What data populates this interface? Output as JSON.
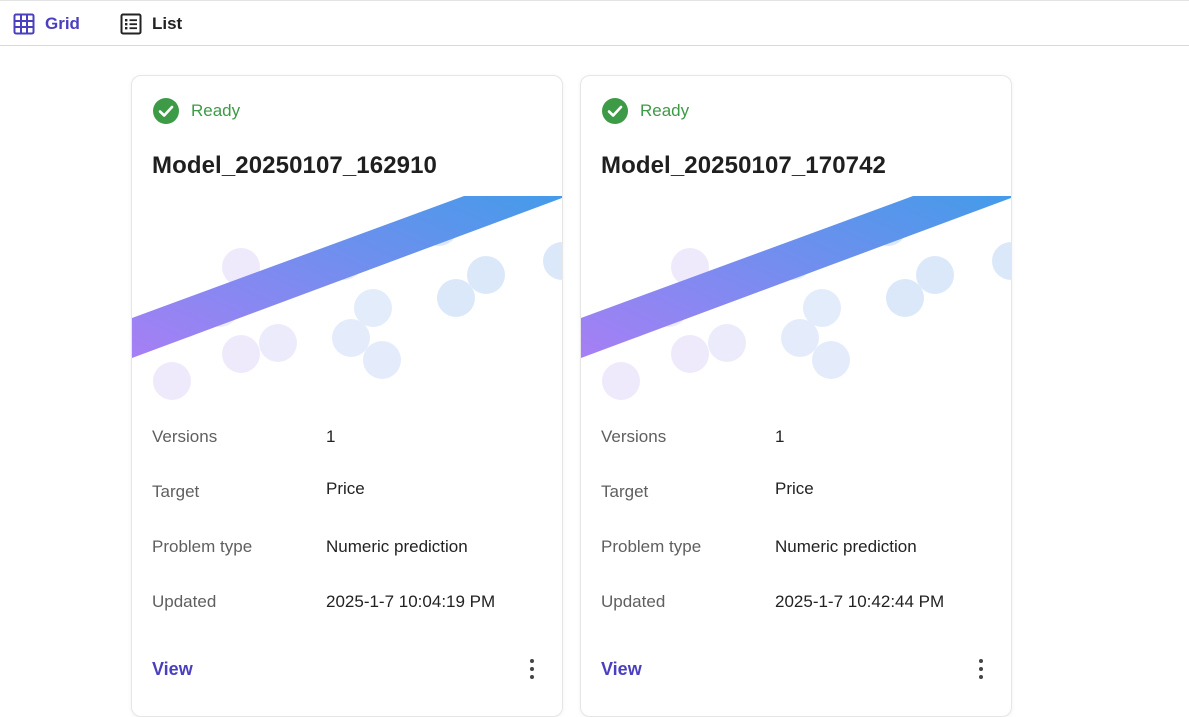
{
  "toolbar": {
    "grid_label": "Grid",
    "list_label": "List",
    "active_color": "#4a3fbf"
  },
  "cards": [
    {
      "status": "Ready",
      "title": "Model_20250107_162910",
      "fields": [
        {
          "label": "Versions",
          "value": "1"
        },
        {
          "label": "Target",
          "value": "Price"
        },
        {
          "label": "Problem type",
          "value": "Numeric prediction"
        },
        {
          "label": "Updated",
          "value": "2025-1-7 10:04:19 PM"
        }
      ],
      "view_label": "View"
    },
    {
      "status": "Ready",
      "title": "Model_20250107_170742",
      "fields": [
        {
          "label": "Versions",
          "value": "1"
        },
        {
          "label": "Target",
          "value": "Price"
        },
        {
          "label": "Problem type",
          "value": "Numeric prediction"
        },
        {
          "label": "Updated",
          "value": "2025-1-7 10:42:44 PM"
        }
      ],
      "view_label": "View"
    }
  ],
  "colors": {
    "status_green": "#3d9a47",
    "link_purple": "#4a3fbf",
    "band_start": "#a77ff5",
    "band_end": "#3a9ee8"
  }
}
